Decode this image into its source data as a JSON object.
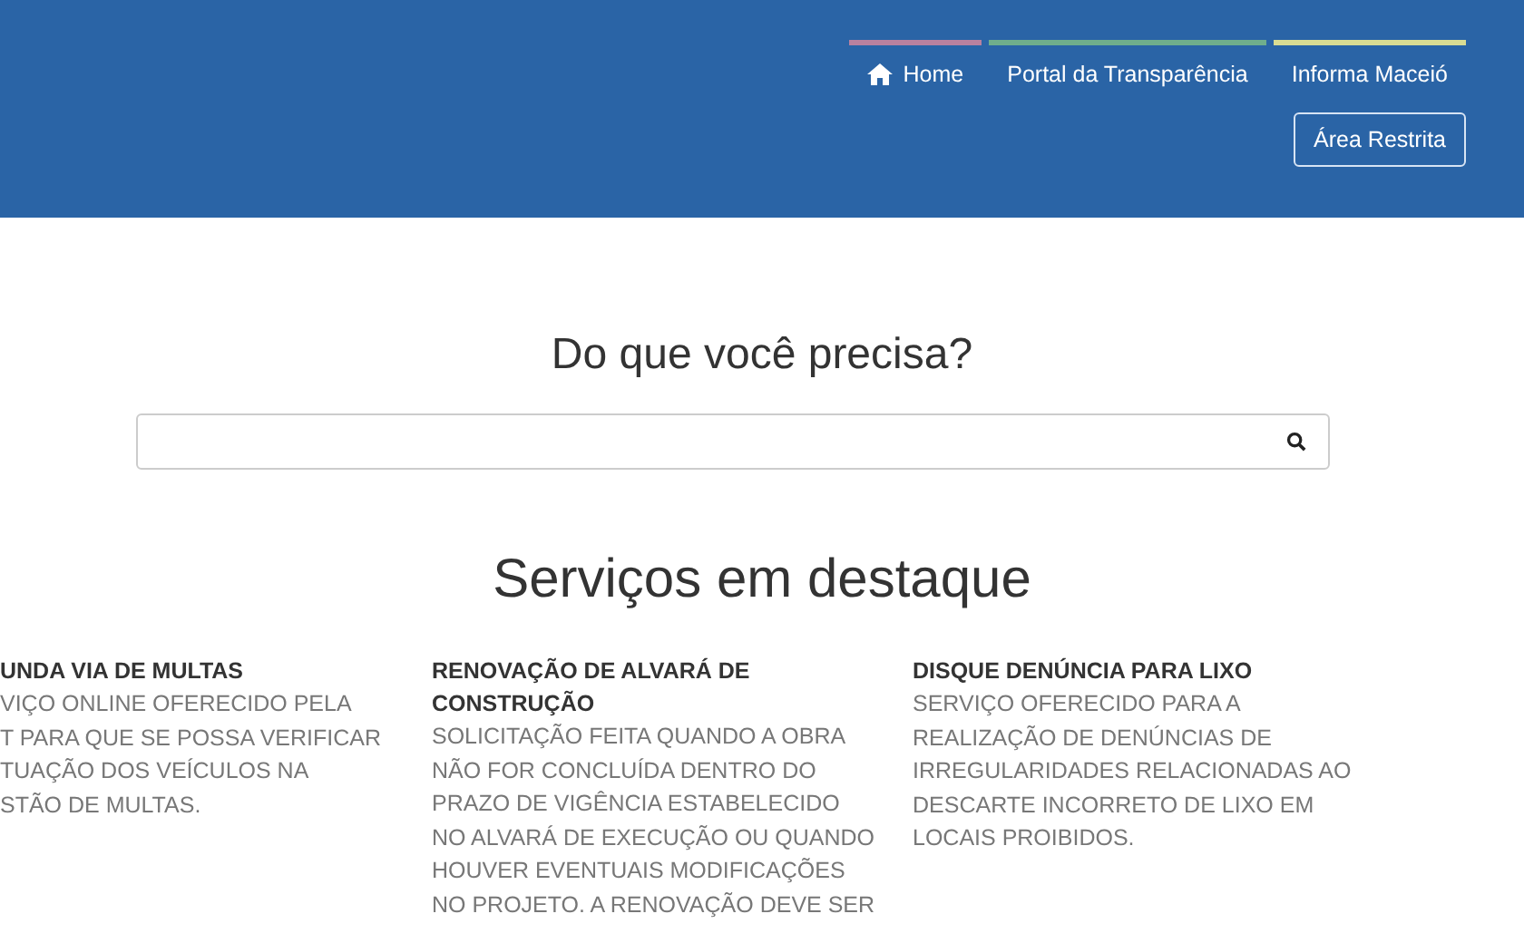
{
  "header": {
    "nav": [
      {
        "label": "Home",
        "kind": "with_icon",
        "color": "#b9819f"
      },
      {
        "label": "Portal da Transparência",
        "color": "#6fae8c"
      },
      {
        "label": "Informa Maceió",
        "color": "#d9dc93"
      }
    ],
    "restricted_button": "Área Restrita"
  },
  "search": {
    "heading": "Do que você precisa?"
  },
  "featured": {
    "heading": "Serviços em destaque",
    "services": [
      {
        "title_lines": [
          "UNDA VIA DE MULTAS"
        ],
        "body_lines": [
          "VIÇO ONLINE OFERECIDO PELA",
          "T PARA QUE SE POSSA VERIFICAR",
          "TUAÇÃO DOS VEÍCULOS NA",
          "STÃO DE MULTAS."
        ]
      },
      {
        "title_lines": [
          "RENOVAÇÃO DE ALVARÁ DE",
          "CONSTRUÇÃO"
        ],
        "body_lines": [
          "SOLICITAÇÃO FEITA QUANDO A OBRA",
          "NÃO FOR CONCLUÍDA DENTRO DO",
          "PRAZO DE VIGÊNCIA ESTABELECIDO",
          "NO ALVARÁ DE EXECUÇÃO OU QUANDO",
          "HOUVER EVENTUAIS MODIFICAÇÕES",
          "NO PROJETO. A RENOVAÇÃO DEVE SER"
        ]
      },
      {
        "title_lines": [
          "DISQUE DENÚNCIA PARA LIXO"
        ],
        "body_lines": [
          "SERVIÇO OFERECIDO PARA A",
          "REALIZAÇÃO DE DENÚNCIAS DE",
          "IRREGULARIDADES RELACIONADAS AO",
          "DESCARTE INCORRETO DE LIXO EM",
          "LOCAIS PROIBIDOS."
        ]
      }
    ]
  }
}
